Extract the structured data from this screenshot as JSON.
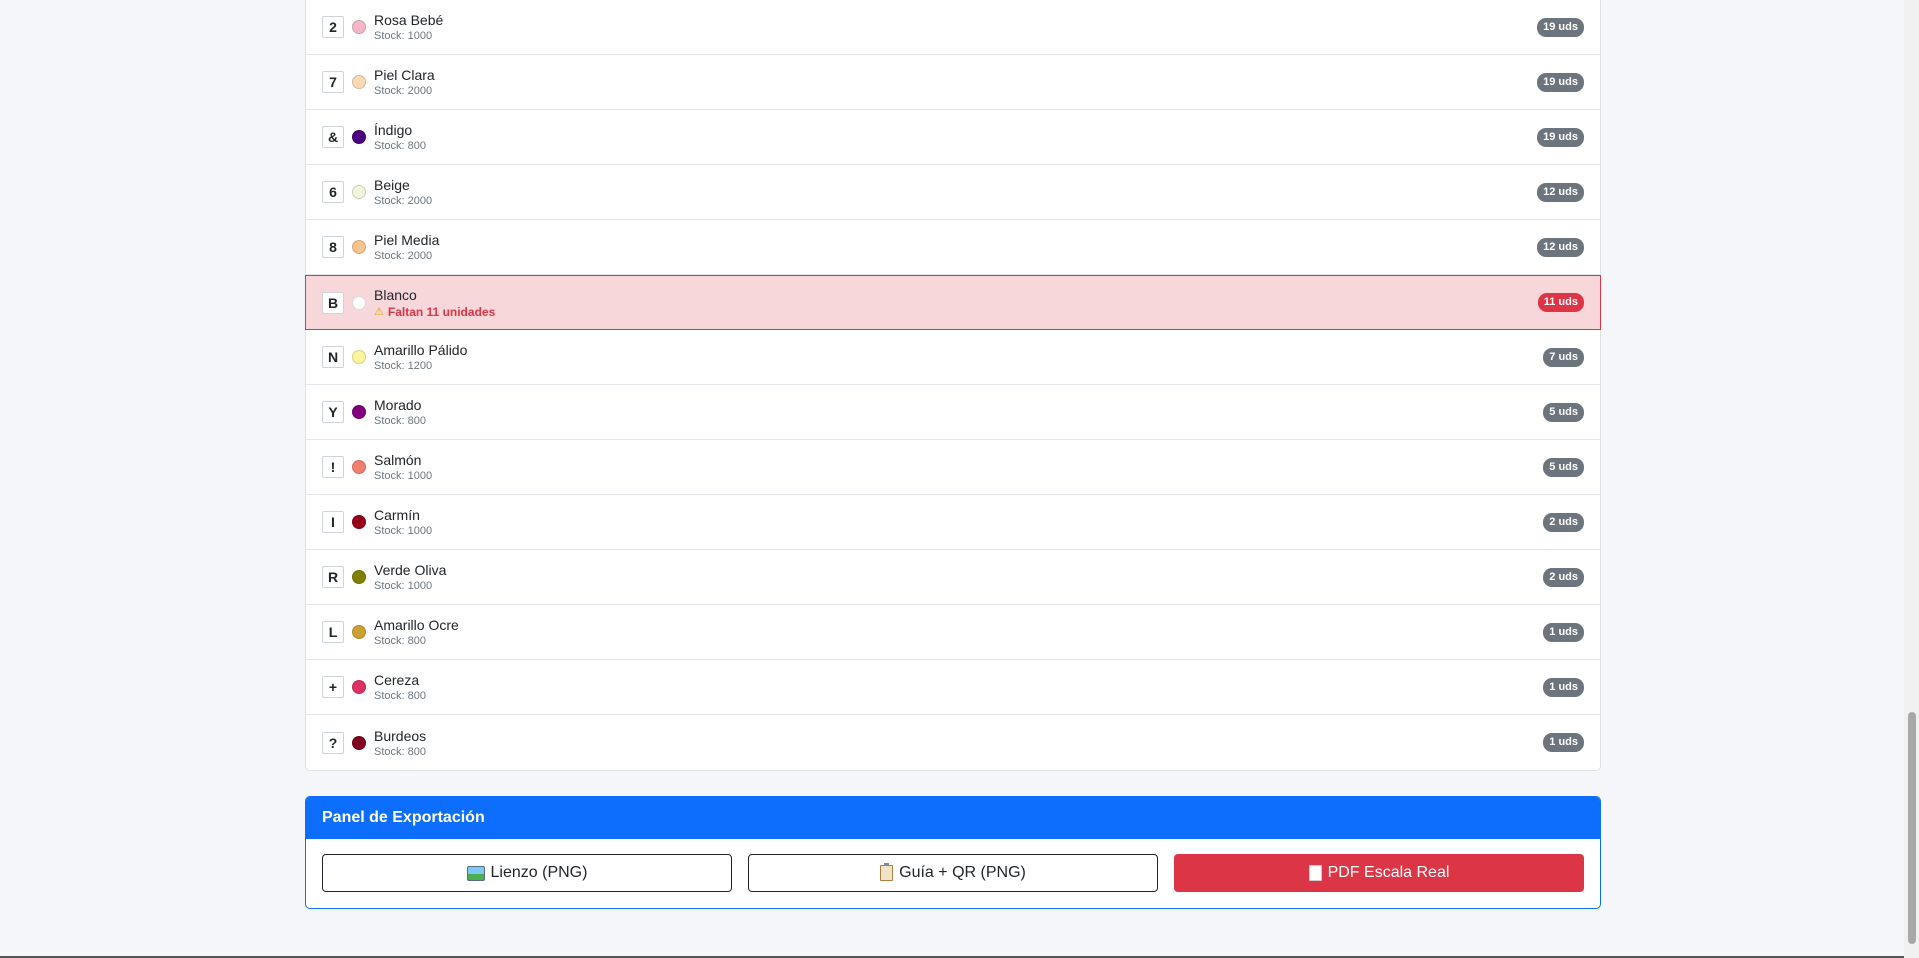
{
  "threads": [
    {
      "symbol": "2",
      "name": "Rosa Bebé",
      "stock": "Stock: 1000",
      "badge": "19 uds",
      "color": "#f4b6c8"
    },
    {
      "symbol": "7",
      "name": "Piel Clara",
      "stock": "Stock: 2000",
      "badge": "19 uds",
      "color": "#fbd9b4"
    },
    {
      "symbol": "&",
      "name": "Índigo",
      "stock": "Stock: 800",
      "badge": "19 uds",
      "color": "#4b0082"
    },
    {
      "symbol": "6",
      "name": "Beige",
      "stock": "Stock: 2000",
      "badge": "12 uds",
      "color": "#f3f5dc"
    },
    {
      "symbol": "8",
      "name": "Piel Media",
      "stock": "Stock: 2000",
      "badge": "12 uds",
      "color": "#f8c58e"
    },
    {
      "symbol": "B",
      "name": "Blanco",
      "warning": "Faltan 11 unidades",
      "badge": "11 uds",
      "color": "#ffffff",
      "alert": true
    },
    {
      "symbol": "N",
      "name": "Amarillo Pálido",
      "stock": "Stock: 1200",
      "badge": "7 uds",
      "color": "#fdf59a"
    },
    {
      "symbol": "Y",
      "name": "Morado",
      "stock": "Stock: 800",
      "badge": "5 uds",
      "color": "#800080"
    },
    {
      "symbol": "!",
      "name": "Salmón",
      "stock": "Stock: 1000",
      "badge": "5 uds",
      "color": "#f07f72"
    },
    {
      "symbol": "I",
      "name": "Carmín",
      "stock": "Stock: 1000",
      "badge": "2 uds",
      "color": "#960018"
    },
    {
      "symbol": "R",
      "name": "Verde Oliva",
      "stock": "Stock: 1000",
      "badge": "2 uds",
      "color": "#808000"
    },
    {
      "symbol": "L",
      "name": "Amarillo Ocre",
      "stock": "Stock: 800",
      "badge": "1 uds",
      "color": "#cca133"
    },
    {
      "symbol": "+",
      "name": "Cereza",
      "stock": "Stock: 800",
      "badge": "1 uds",
      "color": "#de3163"
    },
    {
      "symbol": "?",
      "name": "Burdeos",
      "stock": "Stock: 800",
      "badge": "1 uds",
      "color": "#800020"
    }
  ],
  "export_panel": {
    "title": "Panel de Exportación",
    "buttons": [
      {
        "label": "Lienzo (PNG)",
        "icon": "image-icon",
        "style": "outline"
      },
      {
        "label": "Guía + QR (PNG)",
        "icon": "clipboard-icon",
        "style": "outline"
      },
      {
        "label": "PDF Escala Real",
        "icon": "document-icon",
        "style": "danger"
      }
    ]
  },
  "colors": {
    "primary": "#0d6efd",
    "danger": "#dc3545",
    "badge": "#6c757d",
    "alert_bg": "#f8d7da"
  }
}
